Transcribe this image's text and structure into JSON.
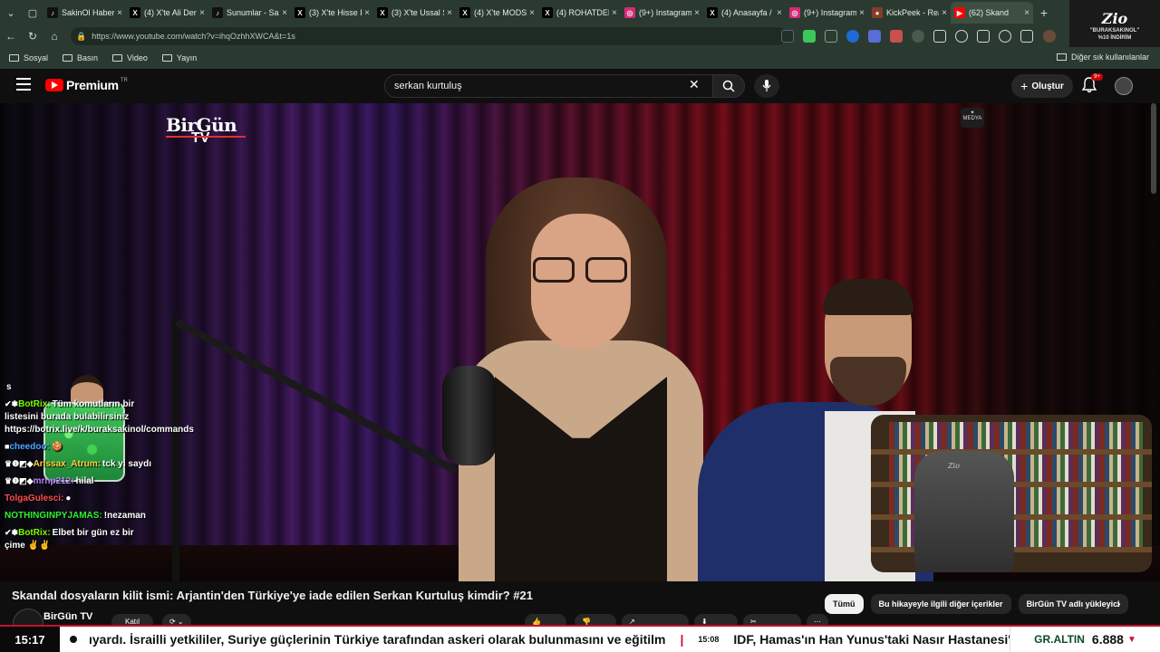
{
  "browser": {
    "tabs": [
      {
        "title": "SakinOl Haber",
        "favicon": "tiktok-icon",
        "color": "#111111",
        "glyph": "♪"
      },
      {
        "title": "(4) X'te Ali Deniz",
        "favicon": "x-icon",
        "color": "#000000",
        "glyph": "X"
      },
      {
        "title": "Sunumlar - Sakin",
        "favicon": "tiktok-icon",
        "color": "#111111",
        "glyph": "♪"
      },
      {
        "title": "(3) X'te Hisse P",
        "favicon": "x-icon",
        "color": "#000000",
        "glyph": "X"
      },
      {
        "title": "(3) X'te Ussal S",
        "favicon": "x-icon",
        "color": "#000000",
        "glyph": "X"
      },
      {
        "title": "(4) X'te MODS",
        "favicon": "x-icon",
        "color": "#000000",
        "glyph": "X"
      },
      {
        "title": "(4) ROHATDEM",
        "favicon": "x-icon",
        "color": "#000000",
        "glyph": "X"
      },
      {
        "title": "(9+) Instagram",
        "favicon": "instagram-icon",
        "color": "#d62976",
        "glyph": "◎"
      },
      {
        "title": "(4) Anasayfa /",
        "favicon": "x-icon",
        "color": "#000000",
        "glyph": "X"
      },
      {
        "title": "(9+) Instagram",
        "favicon": "instagram-icon",
        "color": "#d62976",
        "glyph": "◎"
      },
      {
        "title": "KickPeek - Rea",
        "favicon": "kickpeek-icon",
        "color": "#8a3a2a",
        "glyph": "●"
      },
      {
        "title": "(62) Skand",
        "favicon": "youtube-icon",
        "color": "#ff0000",
        "glyph": "▶",
        "active": true
      }
    ],
    "url": "https://www.youtube.com/watch?v=ihqOzhhXWCA&t=1s",
    "bookmarks": [
      "Sosyal",
      "Basın",
      "Video",
      "Yayın"
    ],
    "bookmarks_other": "Diğer sık kullanılanlar",
    "promo": {
      "logo": "Zio",
      "line1": "\"BURAKSAKINOL\"",
      "line2": "%10 İNDİRİM"
    }
  },
  "youtube": {
    "logo_text": "Premium",
    "logo_region": "TR",
    "search_value": "serkan kurtuluş",
    "create_label": "Oluştur",
    "notif_badge": "9+"
  },
  "video": {
    "channel_logo_top": "BirGün",
    "channel_logo_bottom": "TV",
    "media_btn_label": "MEDYA",
    "webcam_chair_brand": "Zio"
  },
  "chat": {
    "messages": [
      {
        "user": "",
        "text": "s",
        "user_color": "#ffffff"
      },
      {
        "user": "BotRix:",
        "text": "Tüm komutların bir listesini burada bulabilirsiniz https://botrix.live/k/buraksakinol/commands",
        "user_color": "#7cfc00",
        "icons": "✔✽"
      },
      {
        "user": "cheedoo:",
        "text": "🍪",
        "user_color": "#4da6ff",
        "icons": "■"
      },
      {
        "user": "Arissax_Atrum:",
        "text": "tck yi saydı",
        "user_color": "#ffd23f",
        "icons": "♛❶◩◆"
      },
      {
        "user": "mrnp212:",
        "text": "hilal",
        "user_color": "#b983ff",
        "icons": "♛❶◩◆"
      },
      {
        "user": "TolgaGulesci:",
        "text": "●",
        "user_color": "#ff4d4d",
        "icons": ""
      },
      {
        "user": "NOTHINGINPYJAMAS:",
        "text": "!nezaman",
        "user_color": "#2ef22e",
        "icons": ""
      },
      {
        "user": "BotRix:",
        "text": "Elbet bir gün ez bir çime ✌✌",
        "user_color": "#7cfc00",
        "icons": "✔✽"
      }
    ]
  },
  "below_video": {
    "title": "Skandal dosyaların kilit ismi: Arjantin'den Türkiye'ye iade edilen Serkan Kurtuluş kimdir? #21",
    "chips": [
      "Tümü",
      "Bu hikayeyle ilgili diğer içerikler",
      "BirGün TV adlı yükleyici"
    ],
    "channel_name": "BirGün TV",
    "join_label": "Katıl"
  },
  "ticker": {
    "time": "15:17",
    "headline_1": "ıyardı. İsrailli yetkililer, Suriye güçlerinin Türkiye tarafından askeri olarak bulunmasını ve eğitilm",
    "timestamp_2": "15:08",
    "headline_2": "IDF, Hamas'ın Han Yunus'taki Nasır Hastanesi'nde",
    "market_label": "GR.ALTIN",
    "market_value": "6.888",
    "market_trend": "▼"
  }
}
